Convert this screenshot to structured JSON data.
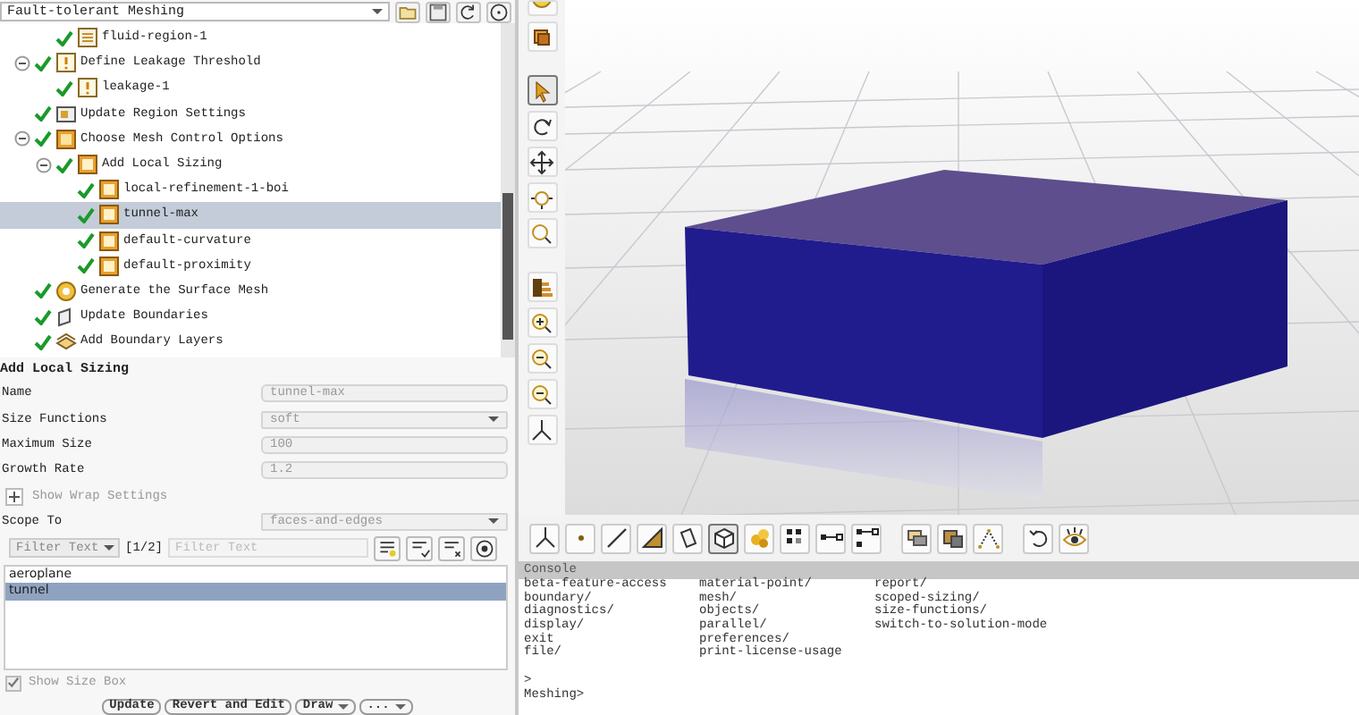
{
  "workflow": {
    "title": "Fault-tolerant Meshing",
    "tool_buttons": [
      {
        "kind": "folder"
      },
      {
        "kind": "save"
      },
      {
        "kind": "refresh"
      },
      {
        "kind": "help"
      }
    ]
  },
  "tree": {
    "continued_children": [
      {
        "label": "fluid-region-1",
        "kind": "region",
        "done": true,
        "selected": false
      }
    ],
    "items": [
      {
        "label": "Define Leakage Threshold",
        "kind": "threshold",
        "done": true,
        "expanded": true,
        "selected": false,
        "children": [
          {
            "label": "leakage-1",
            "kind": "threshold",
            "done": true,
            "selected": false
          }
        ]
      },
      {
        "label": "Update Region Settings",
        "kind": "settings",
        "done": true,
        "selected": false
      },
      {
        "label": "Choose Mesh Control Options",
        "kind": "controls",
        "done": true,
        "expanded": true,
        "selected": false,
        "children": [
          {
            "label": "Add Local Sizing",
            "kind": "sizing",
            "done": true,
            "expanded": true,
            "selected": false,
            "children": [
              {
                "label": "local-refinement-1-boi",
                "kind": "sizing",
                "done": true,
                "selected": false
              },
              {
                "label": "tunnel-max",
                "kind": "sizing",
                "done": true,
                "selected": true
              },
              {
                "label": "default-curvature",
                "kind": "sizing",
                "done": true,
                "selected": false
              },
              {
                "label": "default-proximity",
                "kind": "sizing",
                "done": true,
                "selected": false
              }
            ]
          }
        ]
      },
      {
        "label": "Generate the Surface Mesh",
        "kind": "surface",
        "done": true,
        "selected": false
      },
      {
        "label": "Update Boundaries",
        "kind": "boundaries",
        "done": true,
        "selected": false
      },
      {
        "label": "Add Boundary Layers",
        "kind": "layers",
        "done": true,
        "selected": false
      }
    ]
  },
  "form": {
    "title": "Add Local Sizing",
    "fields": [
      {
        "label": "Name",
        "kind": "text",
        "value": "tunnel-max",
        "disabled": true
      },
      {
        "label": "Size Functions",
        "kind": "select",
        "value": "soft",
        "disabled": true
      },
      {
        "label": "Maximum Size",
        "kind": "text",
        "value": "100",
        "disabled": true
      },
      {
        "label": "Growth Rate",
        "kind": "text",
        "value": "1.2",
        "disabled": true
      }
    ],
    "wrap_settings": {
      "label": "Show Wrap Settings",
      "expanded": false
    },
    "scope": {
      "label": "Scope To",
      "kind": "select",
      "value": "faces-and-edges",
      "disabled": true
    },
    "filter": {
      "mode": "Filter Text",
      "count": "[1/2]",
      "placeholder": "Filter Text",
      "tool_buttons": [
        {
          "kind": "list-add"
        },
        {
          "kind": "list-check"
        },
        {
          "kind": "list-clear"
        },
        {
          "kind": "target"
        }
      ]
    },
    "list": [
      {
        "label": "aeroplane",
        "selected": false
      },
      {
        "label": "tunnel",
        "selected": true
      }
    ],
    "show_size_box": {
      "label": "Show Size Box",
      "checked": true,
      "disabled": true
    },
    "buttons": [
      {
        "label": "Update",
        "dropdown": false
      },
      {
        "label": "Revert and Edit",
        "dropdown": false
      },
      {
        "label": "Draw",
        "dropdown": true
      },
      {
        "label": "...",
        "dropdown": true
      }
    ]
  },
  "vertical_toolbar": [
    [
      {
        "kind": "sphere",
        "selected": false
      },
      {
        "kind": "cubes",
        "selected": false
      }
    ],
    [
      {
        "kind": "pointer",
        "selected": true
      },
      {
        "kind": "rotate",
        "selected": false
      },
      {
        "kind": "pan",
        "selected": false
      },
      {
        "kind": "zoom-box",
        "selected": false
      },
      {
        "kind": "zoom",
        "selected": false
      }
    ],
    [
      {
        "kind": "bars",
        "selected": false
      },
      {
        "kind": "zoom-in",
        "selected": false
      },
      {
        "kind": "zoom-out",
        "selected": false
      },
      {
        "kind": "zoom-out",
        "selected": false
      },
      {
        "kind": "axes",
        "selected": false
      }
    ]
  ],
  "bottom_toolbar": [
    [
      {
        "kind": "axes",
        "selected": false
      },
      {
        "kind": "point",
        "selected": false
      },
      {
        "kind": "line",
        "selected": false
      },
      {
        "kind": "triangle",
        "selected": false
      },
      {
        "kind": "face",
        "selected": false
      },
      {
        "kind": "cube",
        "selected": true
      },
      {
        "kind": "blobs",
        "selected": false
      },
      {
        "kind": "dots",
        "selected": false
      },
      {
        "kind": "edge",
        "selected": false
      },
      {
        "kind": "nodes",
        "selected": false
      }
    ],
    [
      {
        "kind": "tag",
        "selected": false
      },
      {
        "kind": "cube-tag",
        "selected": false
      },
      {
        "kind": "scatter",
        "selected": false
      }
    ],
    [
      {
        "kind": "undo",
        "selected": false
      },
      {
        "kind": "eye",
        "selected": false
      }
    ]
  ],
  "console": {
    "title": "Console",
    "columns": [
      [
        "beta-feature-access",
        "boundary/",
        "diagnostics/",
        "display/",
        "exit",
        "file/"
      ],
      [
        "material-point/",
        "mesh/",
        "objects/",
        "parallel/",
        "preferences/",
        "print-license-usage"
      ],
      [
        "report/",
        "scoped-sizing/",
        "size-functions/",
        "switch-to-solution-mode"
      ]
    ],
    "lines": [
      ">",
      "Meshing>"
    ]
  }
}
